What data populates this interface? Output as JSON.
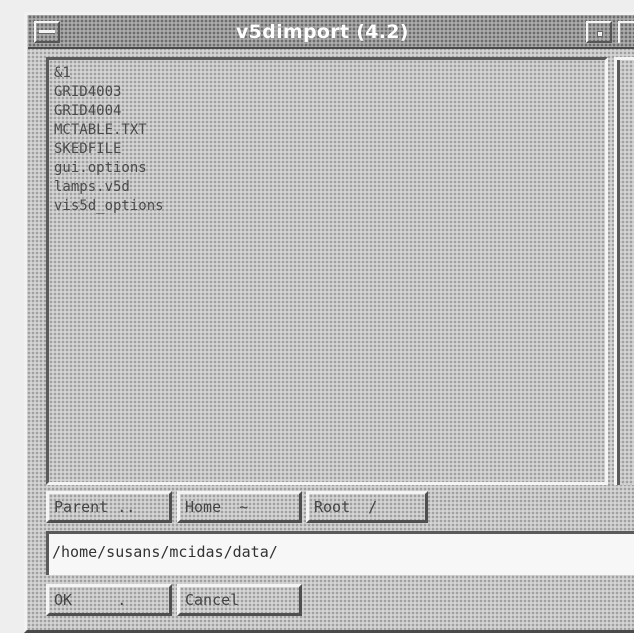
{
  "window": {
    "title": "v5dimport (4.2)"
  },
  "file_list": {
    "items": [
      "&1",
      "GRID4003",
      "GRID4004",
      "MCTABLE.TXT",
      "SKEDFILE",
      "gui.options",
      "lamps.v5d",
      "vis5d_options"
    ]
  },
  "nav_buttons": {
    "parent_label": "Parent ..",
    "home_label": "Home  ~",
    "root_label": "Root  /"
  },
  "path_field": {
    "value": "/home/susans/mcidas/data/"
  },
  "dialog_buttons": {
    "ok_label": "OK     .",
    "cancel_label": "Cancel"
  }
}
